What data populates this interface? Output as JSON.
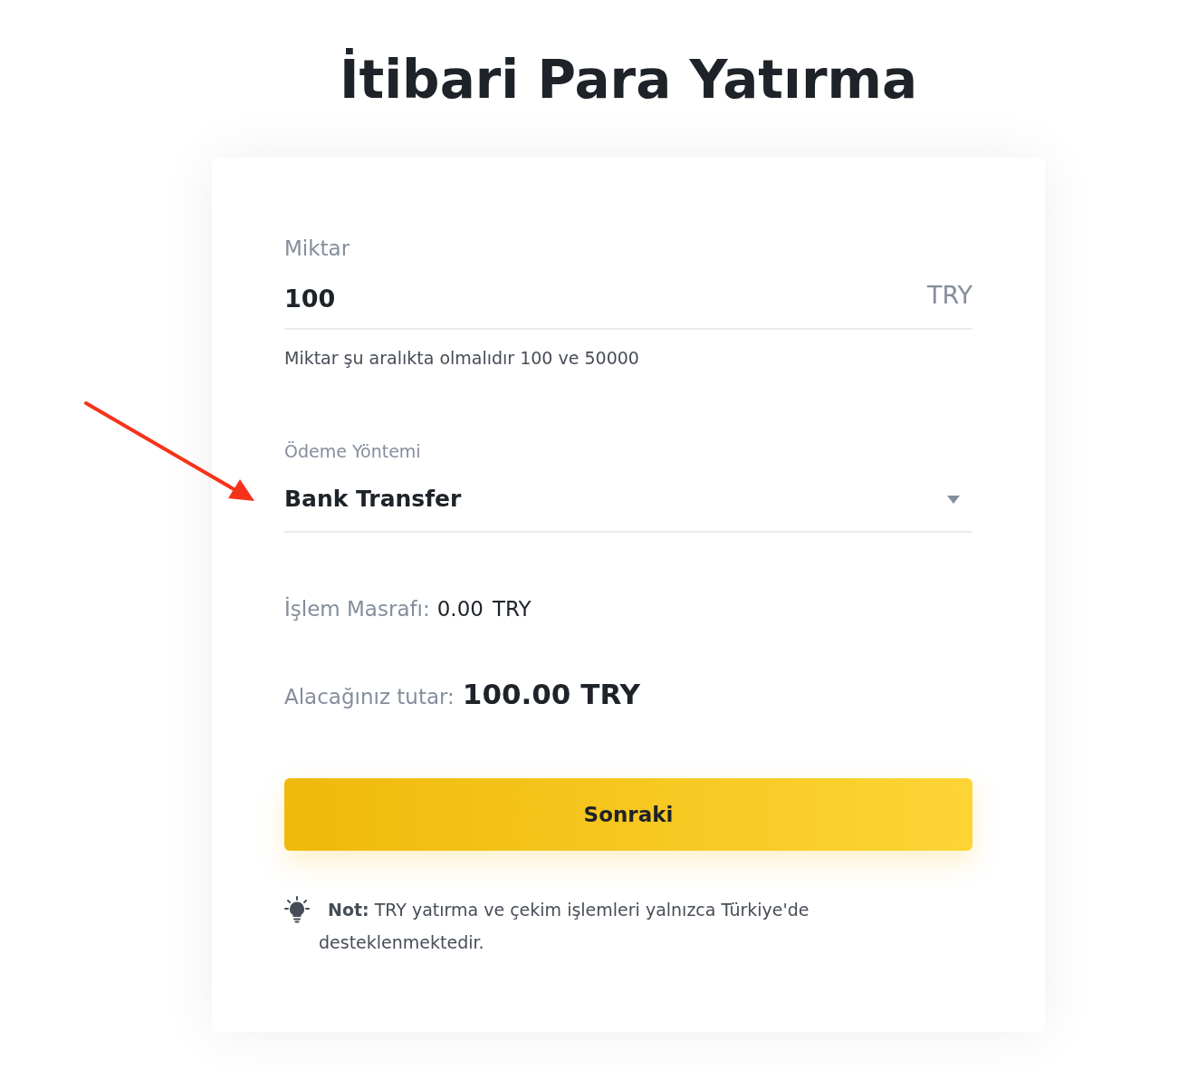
{
  "title": "İtibari Para Yatırma",
  "amount": {
    "label": "Miktar",
    "value": "100",
    "currency": "TRY",
    "hint": "Miktar şu aralıkta olmalıdır 100 ve 50000"
  },
  "payment_method": {
    "label": "Ödeme Yöntemi",
    "value": "Bank Transfer"
  },
  "fee": {
    "label": "İşlem Masrafı:",
    "value": "0.00",
    "currency": "TRY"
  },
  "receive": {
    "label": "Alacağınız tutar:",
    "value": "100.00 TRY"
  },
  "next_button": "Sonraki",
  "note": "**Not:**  TRY yatırma ve çekim işlemleri yalnızca Türkiye'de desteklenmektedir."
}
